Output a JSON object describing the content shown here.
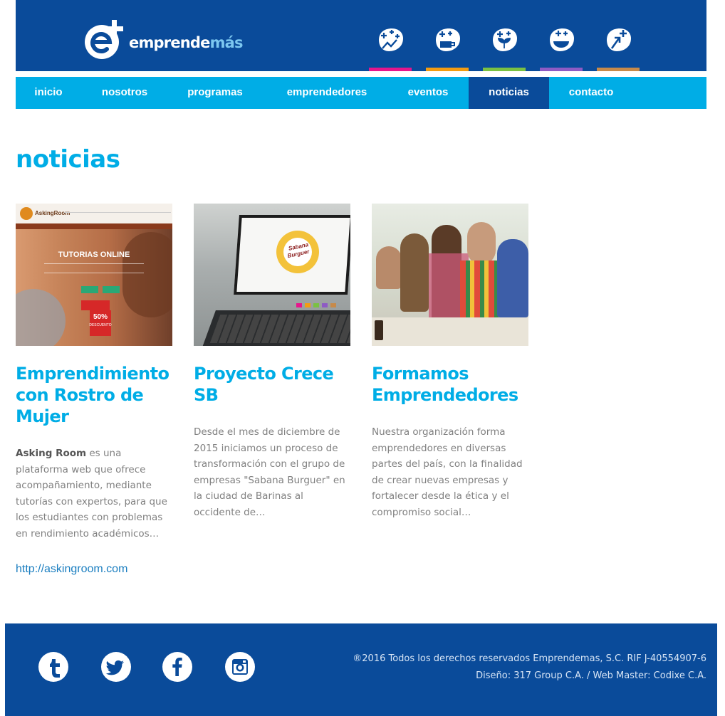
{
  "brand": {
    "logo_main": "emprende",
    "logo_accent": "más",
    "colors": {
      "dark_blue": "#0a4b9a",
      "light_blue": "#00ade6"
    }
  },
  "programs": [
    {
      "icon": "hand-plus-icon",
      "color": "#e6168c"
    },
    {
      "icon": "cup-plus-icon",
      "color": "#f39c12"
    },
    {
      "icon": "leaf-plus-icon",
      "color": "#7ac143"
    },
    {
      "icon": "bowl-plus-icon",
      "color": "#8e5bc4"
    },
    {
      "icon": "arrow-plus-icon",
      "color": "#c78a4a"
    }
  ],
  "nav": {
    "items": [
      "inicio",
      "nosotros",
      "programas",
      "emprendedores",
      "eventos",
      "noticias",
      "contacto"
    ],
    "active": "noticias"
  },
  "page": {
    "title": "noticias"
  },
  "articles": [
    {
      "title": "Emprendimiento con Rostro de Mujer",
      "body_strong": "Asking Room",
      "body": " es una plataforma web que ofrece acompañamiento, mediante tutorías con expertos, para que los estudiantes con problemas en rendimiento académicos…",
      "link": "http://askingroom.com",
      "thumb": {
        "brand": "AskingRoom",
        "headline": "TUTORIAS ONLINE",
        "badge": "50%",
        "badge_sub": "DESCUENTO"
      }
    },
    {
      "title": "Proyecto Crece SB",
      "body": "Desde el mes de diciembre de 2015 iniciamos un proceso de transformación con el grupo de empresas \"Sabana Burguer\" en la ciudad de Barinas al occidente de…",
      "thumb": {
        "brand_line1": "Sabana",
        "brand_line2": "Burguer"
      }
    },
    {
      "title": "Formamos Emprendedores",
      "body": "Nuestra organización forma emprendedores en diversas partes del país, con la finalidad de crear nuevas empresas y fortalecer desde la ética y el compromiso social…"
    }
  ],
  "footer": {
    "social": [
      "tumblr-icon",
      "twitter-icon",
      "facebook-icon",
      "instagram-icon"
    ],
    "copyright": "®2016 Todos los derechos reservados Emprendemas, S.C. RIF J-40554907-6",
    "credits": "Diseño: 317 Group C.A. / Web Master: Codixe C.A."
  }
}
